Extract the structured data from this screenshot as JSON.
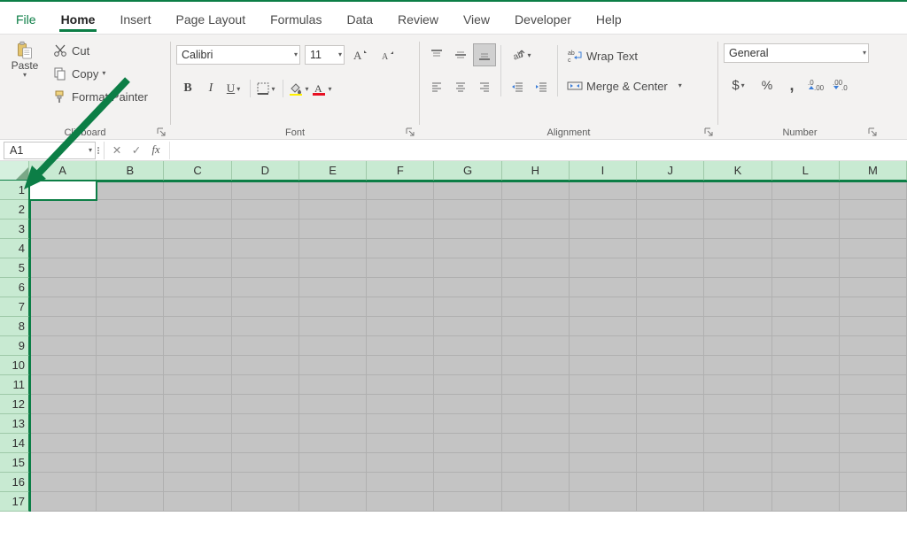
{
  "tabs": {
    "file": "File",
    "home": "Home",
    "insert": "Insert",
    "page_layout": "Page Layout",
    "formulas": "Formulas",
    "data": "Data",
    "review": "Review",
    "view": "View",
    "developer": "Developer",
    "help": "Help"
  },
  "clipboard": {
    "paste": "Paste",
    "cut": "Cut",
    "copy": "Copy",
    "format_painter": "Format Painter",
    "group_label": "Clipboard"
  },
  "font": {
    "name": "Calibri",
    "size": "11",
    "group_label": "Font"
  },
  "alignment": {
    "wrap_text": "Wrap Text",
    "merge_center": "Merge & Center",
    "group_label": "Alignment"
  },
  "number": {
    "format": "General",
    "group_label": "Number"
  },
  "name_box": "A1",
  "fx_label": "fx",
  "columns": [
    "A",
    "B",
    "C",
    "D",
    "E",
    "F",
    "G",
    "H",
    "I",
    "J",
    "K",
    "L",
    "M"
  ],
  "rows": [
    1,
    2,
    3,
    4,
    5,
    6,
    7,
    8,
    9,
    10,
    11,
    12,
    13,
    14,
    15,
    16,
    17
  ]
}
